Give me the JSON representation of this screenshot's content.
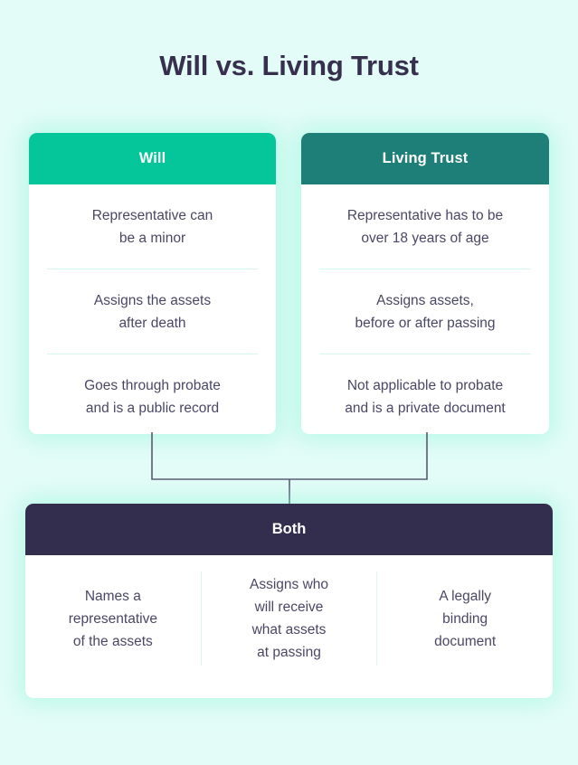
{
  "title": "Will vs. Living Trust",
  "colors": {
    "background": "#e4fcf7",
    "will_header": "#04c69a",
    "trust_header": "#1d7f77",
    "both_header": "#332d4e",
    "title_text": "#372f4e",
    "body_text": "#4a4765",
    "divider": "#d6f7ec",
    "connector_line": "#5b5874"
  },
  "columns": [
    {
      "header": "Will",
      "facts": [
        "Representative can\nbe a minor",
        "Assigns the assets\nafter death",
        "Goes through probate\nand is a public record"
      ]
    },
    {
      "header": "Living Trust",
      "facts": [
        "Representative has to be\nover 18 years of age",
        "Assigns assets,\nbefore or after passing",
        "Not applicable to probate\nand is a private document"
      ]
    }
  ],
  "both": {
    "header": "Both",
    "items": [
      "Names a\nrepresentative\nof the assets",
      "Assigns who\nwill receive\nwhat assets\nat passing",
      "A legally\nbinding\ndocument"
    ]
  }
}
